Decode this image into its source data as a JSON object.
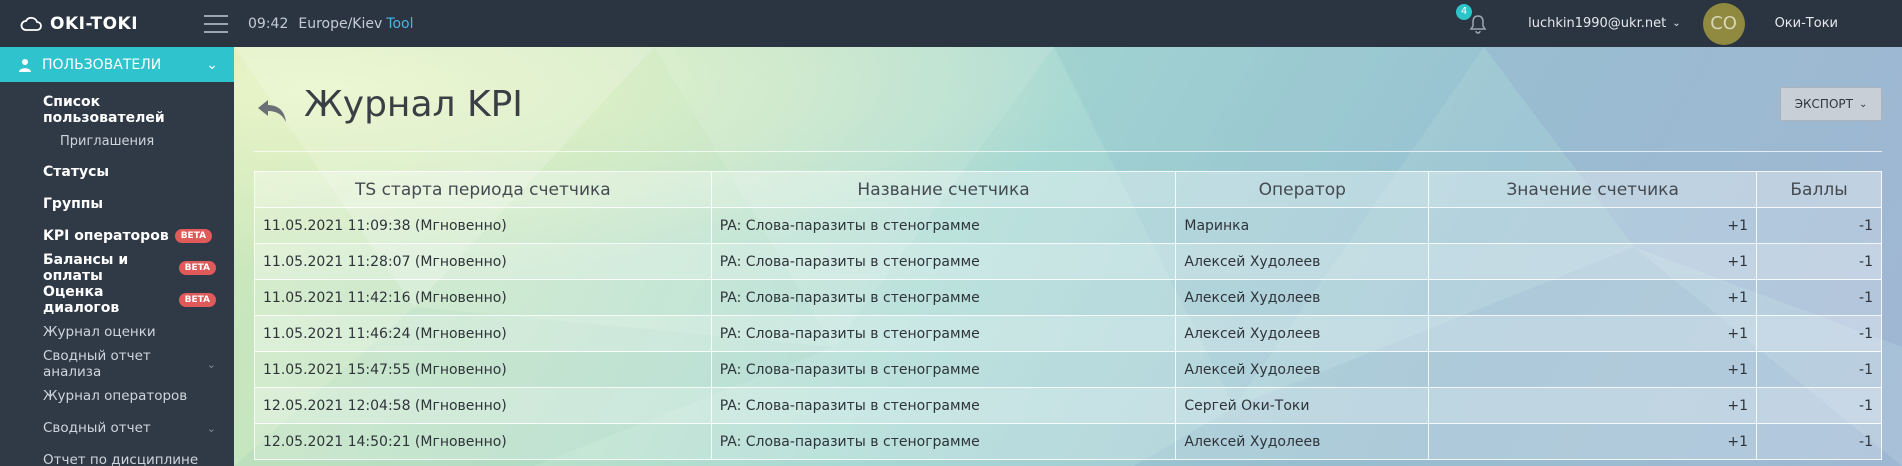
{
  "topbar": {
    "brand": "OKI-TOKI",
    "time": "09:42",
    "timezone": "Europe/Kiev",
    "tool_label": "Tool",
    "notifications_count": "4",
    "user_email": "luchkin1990@ukr.net",
    "avatar_initials": "CO",
    "company_name": "Оки-Токи"
  },
  "sidebar": {
    "section_title": "ПОЛЬЗОВАТЕЛИ",
    "items": [
      {
        "label": "Список пользователей"
      },
      {
        "label": "Приглашения"
      },
      {
        "label": "Статусы"
      },
      {
        "label": "Группы"
      },
      {
        "label": "KPI операторов",
        "badge": "BETA"
      },
      {
        "label": "Балансы и оплаты",
        "badge": "BETA"
      },
      {
        "label": "Оценка диалогов",
        "badge": "BETA"
      },
      {
        "label": "Журнал оценки"
      },
      {
        "label": "Сводный отчет анализа"
      },
      {
        "label": "Журнал операторов"
      },
      {
        "label": "Сводный отчет"
      },
      {
        "label": "Отчет по дисциплине"
      }
    ]
  },
  "main": {
    "title": "Журнал KPI",
    "export_label": "ЭКСПОРТ",
    "table": {
      "headers": [
        "TS старта периода счетчика",
        "Название счетчика",
        "Оператор",
        "Значение счетчика",
        "Баллы"
      ],
      "rows": [
        [
          "11.05.2021 11:09:38 (Мгновенно)",
          "PA: Слова-паразиты в стенограмме",
          "Маринка",
          "+1",
          "-1"
        ],
        [
          "11.05.2021 11:28:07 (Мгновенно)",
          "PA: Слова-паразиты в стенограмме",
          "Алексей Худолеев",
          "+1",
          "-1"
        ],
        [
          "11.05.2021 11:42:16 (Мгновенно)",
          "PA: Слова-паразиты в стенограмме",
          "Алексей Худолеев",
          "+1",
          "-1"
        ],
        [
          "11.05.2021 11:46:24 (Мгновенно)",
          "PA: Слова-паразиты в стенограмме",
          "Алексей Худолеев",
          "+1",
          "-1"
        ],
        [
          "11.05.2021 15:47:55 (Мгновенно)",
          "PA: Слова-паразиты в стенограмме",
          "Алексей Худолеев",
          "+1",
          "-1"
        ],
        [
          "12.05.2021 12:04:58 (Мгновенно)",
          "PA: Слова-паразиты в стенограмме",
          "Сергей Оки-Токи",
          "+1",
          "-1"
        ],
        [
          "12.05.2021 14:50:21 (Мгновенно)",
          "PA: Слова-паразиты в стенограмме",
          "Алексей Худолеев",
          "+1",
          "-1"
        ]
      ]
    }
  },
  "colors": {
    "topbar_bg": "#2a3541",
    "sidebar_bg": "#2f3a46",
    "accent": "#2ec3cd",
    "badge": "#e05a59",
    "tool_link": "#4bb3e4"
  }
}
